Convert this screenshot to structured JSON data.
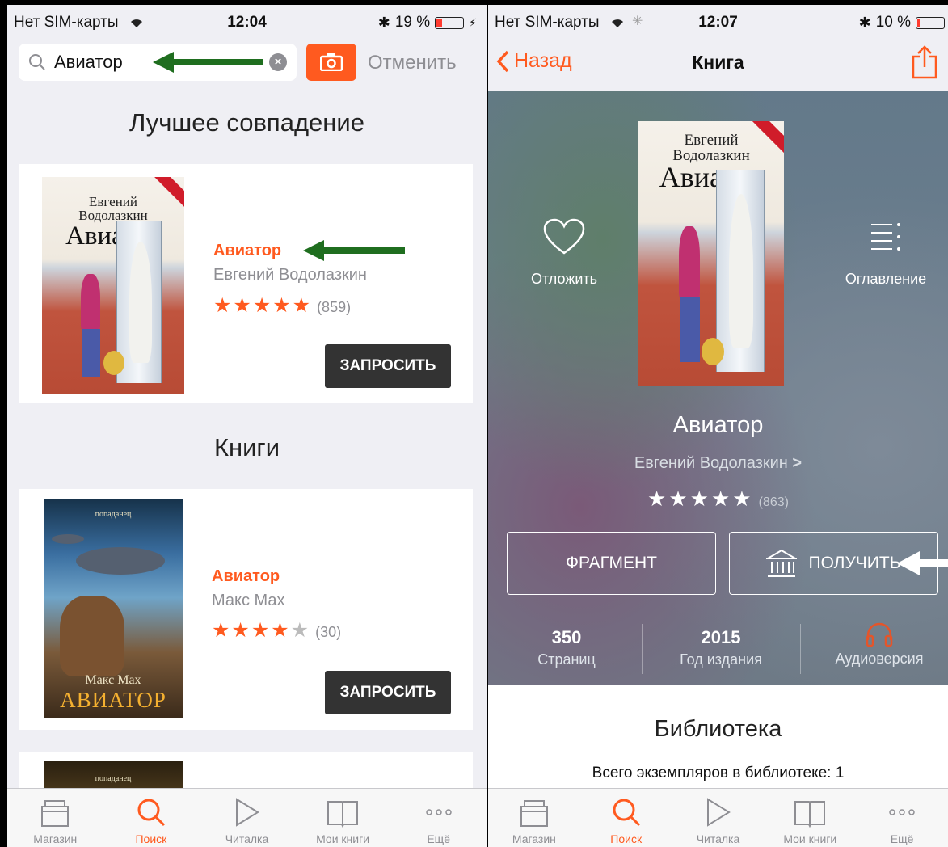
{
  "left": {
    "status": {
      "carrier": "Нет SIM-карты",
      "time": "12:04",
      "battery": "19 %",
      "battery_level": 0.19
    },
    "search": {
      "value": "Авиатор",
      "cancel_label": "Отменить"
    },
    "best_match": {
      "heading": "Лучшее совпадение",
      "book": {
        "cover_author_line1": "Евгений",
        "cover_author_line2": "Водолазкин",
        "cover_title": "Авиатор",
        "title": "Авиатор",
        "author": "Евгений Водолазкин",
        "stars_filled": "★★★★★",
        "stars_empty": "",
        "rating_count": "(859)",
        "action_label": "ЗАПРОСИТЬ"
      }
    },
    "books": {
      "heading": "Книги",
      "items": [
        {
          "cover_series": "попаданец",
          "cover_author": "Макс Мах",
          "cover_title": "АВИАТОР",
          "title": "Авиатор",
          "author": "Макс Мах",
          "stars_filled": "★★★★",
          "stars_empty": "★",
          "rating_count": "(30)",
          "action_label": "ЗАПРОСИТЬ"
        }
      ],
      "next_cover_series": "попаданец"
    },
    "tabs": [
      {
        "label": "Магазин",
        "icon": "store-icon"
      },
      {
        "label": "Поиск",
        "icon": "search-icon",
        "active": true
      },
      {
        "label": "Читалка",
        "icon": "play-icon"
      },
      {
        "label": "Мои книги",
        "icon": "book-icon"
      },
      {
        "label": "Ещё",
        "icon": "more-icon"
      }
    ]
  },
  "right": {
    "status": {
      "carrier": "Нет SIM-карты",
      "time": "12:07",
      "battery": "10 %",
      "battery_level": 0.1
    },
    "nav": {
      "back_label": "Назад",
      "title": "Книга"
    },
    "book": {
      "cover_author_line1": "Евгений",
      "cover_author_line2": "Водолазкин",
      "cover_title": "Авиатор",
      "title": "Авиатор",
      "author": "Евгений Водолазкин",
      "stars_filled": "★★★★★",
      "rating_count": "(863)",
      "wishlist_label": "Отложить",
      "toc_label": "Оглавление",
      "fragment_label": "ФРАГМЕНТ",
      "get_label": "ПОЛУЧИТЬ",
      "stats": [
        {
          "value": "350",
          "label": "Страниц"
        },
        {
          "value": "2015",
          "label": "Год издания"
        },
        {
          "value": "",
          "label": "Аудиоверсия"
        }
      ]
    },
    "library": {
      "heading": "Библиотека",
      "copies_text": "Всего экземпляров в библиотеке: 1"
    },
    "tabs": [
      {
        "label": "Магазин",
        "icon": "store-icon"
      },
      {
        "label": "Поиск",
        "icon": "search-icon",
        "active": true
      },
      {
        "label": "Читалка",
        "icon": "play-icon"
      },
      {
        "label": "Мои книги",
        "icon": "book-icon"
      },
      {
        "label": "Ещё",
        "icon": "more-icon"
      }
    ]
  },
  "colors": {
    "accent": "#ff5a1f",
    "dark_button": "#333333",
    "arrow": "#1f6e1f"
  }
}
